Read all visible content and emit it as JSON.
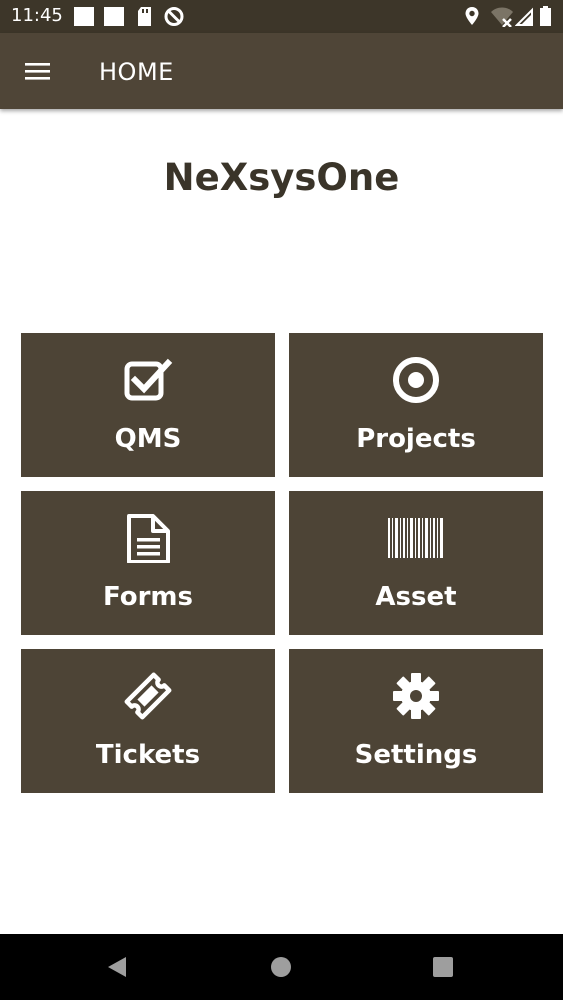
{
  "status_bar": {
    "time": "11:45",
    "left_icons": [
      "notification-square-icon",
      "notification-square-icon",
      "sd-card-icon",
      "blocked-app-icon"
    ],
    "right_icons": [
      "location-icon",
      "wifi-off-icon",
      "signal-icon",
      "battery-icon"
    ]
  },
  "app_bar": {
    "menu_icon": "hamburger-menu-icon",
    "title": "HOME"
  },
  "brand": {
    "name": "NeXsysOne"
  },
  "tiles": [
    {
      "label": "QMS",
      "icon": "checkbox-icon"
    },
    {
      "label": "Projects",
      "icon": "target-icon"
    },
    {
      "label": "Forms",
      "icon": "document-icon"
    },
    {
      "label": "Asset",
      "icon": "barcode-icon"
    },
    {
      "label": "Tickets",
      "icon": "ticket-icon"
    },
    {
      "label": "Settings",
      "icon": "gear-icon"
    }
  ],
  "nav_bar": {
    "buttons": [
      "back-icon",
      "home-icon",
      "recents-icon"
    ]
  },
  "colors": {
    "status_bar": "#3d3629",
    "app_bar": "#4f4537",
    "tile": "#4d4436",
    "brand_text": "#3a3429",
    "nav_bar": "#000000"
  }
}
